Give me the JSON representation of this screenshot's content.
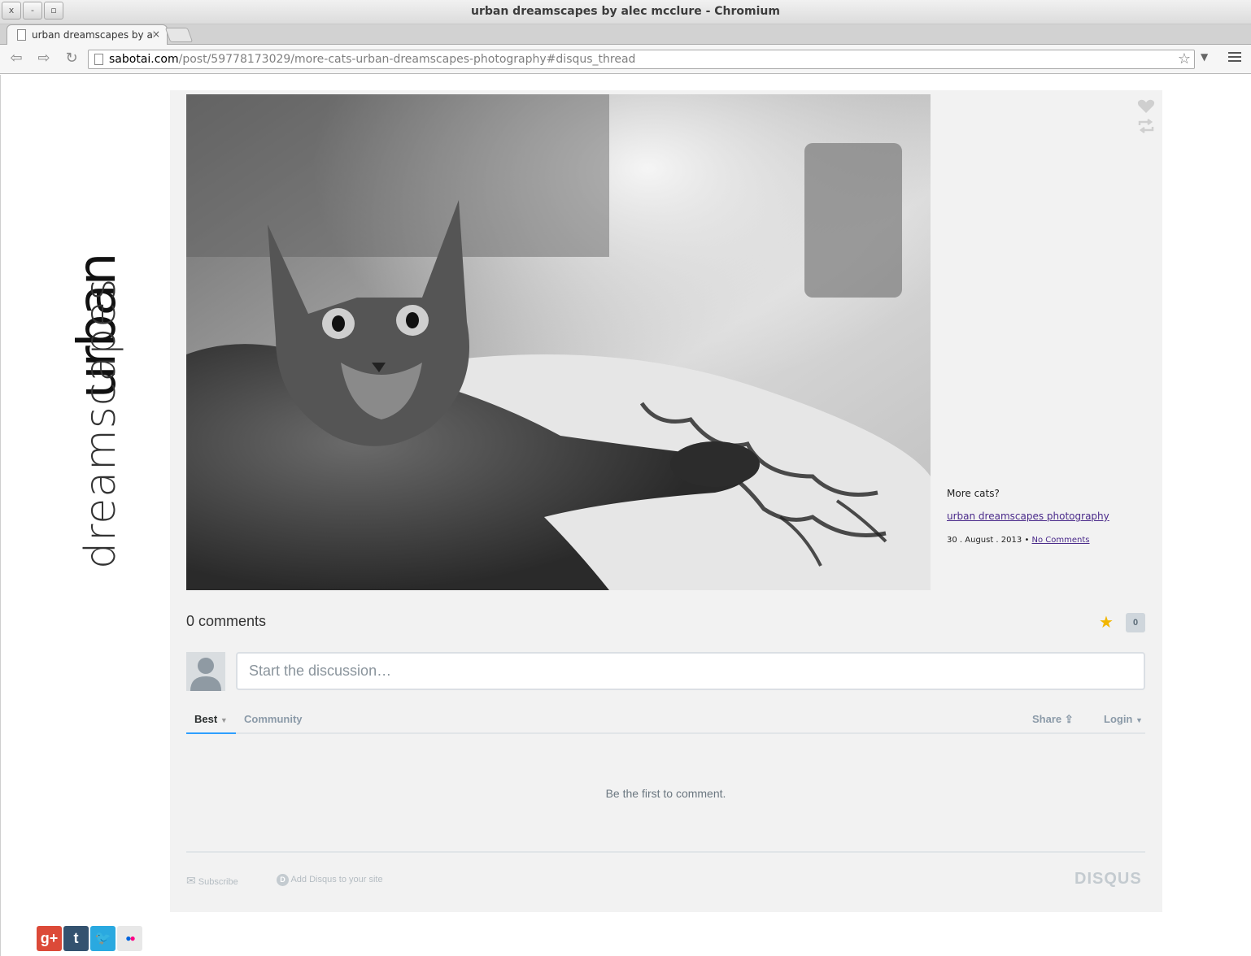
{
  "window": {
    "title": "urban dreamscapes by alec mcclure - Chromium",
    "buttons": [
      "x",
      "-",
      "▫"
    ]
  },
  "tab": {
    "title": "urban dreamscapes by ale",
    "close": "×"
  },
  "toolbar": {
    "url_host": "sabotai.com",
    "url_path": "/post/59778173029/more-cats-urban-dreamscapes-photography#disqus_thread"
  },
  "blog": {
    "logo_word1": "urban",
    "logo_word2": "dreamscapes"
  },
  "post": {
    "caption": "More cats?",
    "link_text": "urban dreamscapes photography",
    "date": "30 . August . 2013",
    "separator": "•",
    "comments_link": "No Comments"
  },
  "disqus": {
    "comment_count": "0 comments",
    "recommend_count": "0",
    "placeholder": "Start the discussion…",
    "tab_best": "Best",
    "tab_community": "Community",
    "share": "Share",
    "login": "Login",
    "empty_message": "Be the first to comment.",
    "subscribe": "Subscribe",
    "add_disqus": "Add Disqus to your site",
    "logo": "DISQUS"
  },
  "social": [
    {
      "name": "google-plus",
      "glyph": "g+",
      "color": "#dc4a38"
    },
    {
      "name": "tumblr",
      "glyph": "t",
      "color": "#34526f"
    },
    {
      "name": "twitter",
      "glyph": "t",
      "color": "#2aa9e0"
    },
    {
      "name": "flickr",
      "glyph": "●●",
      "color": "#e8e8e8"
    }
  ]
}
